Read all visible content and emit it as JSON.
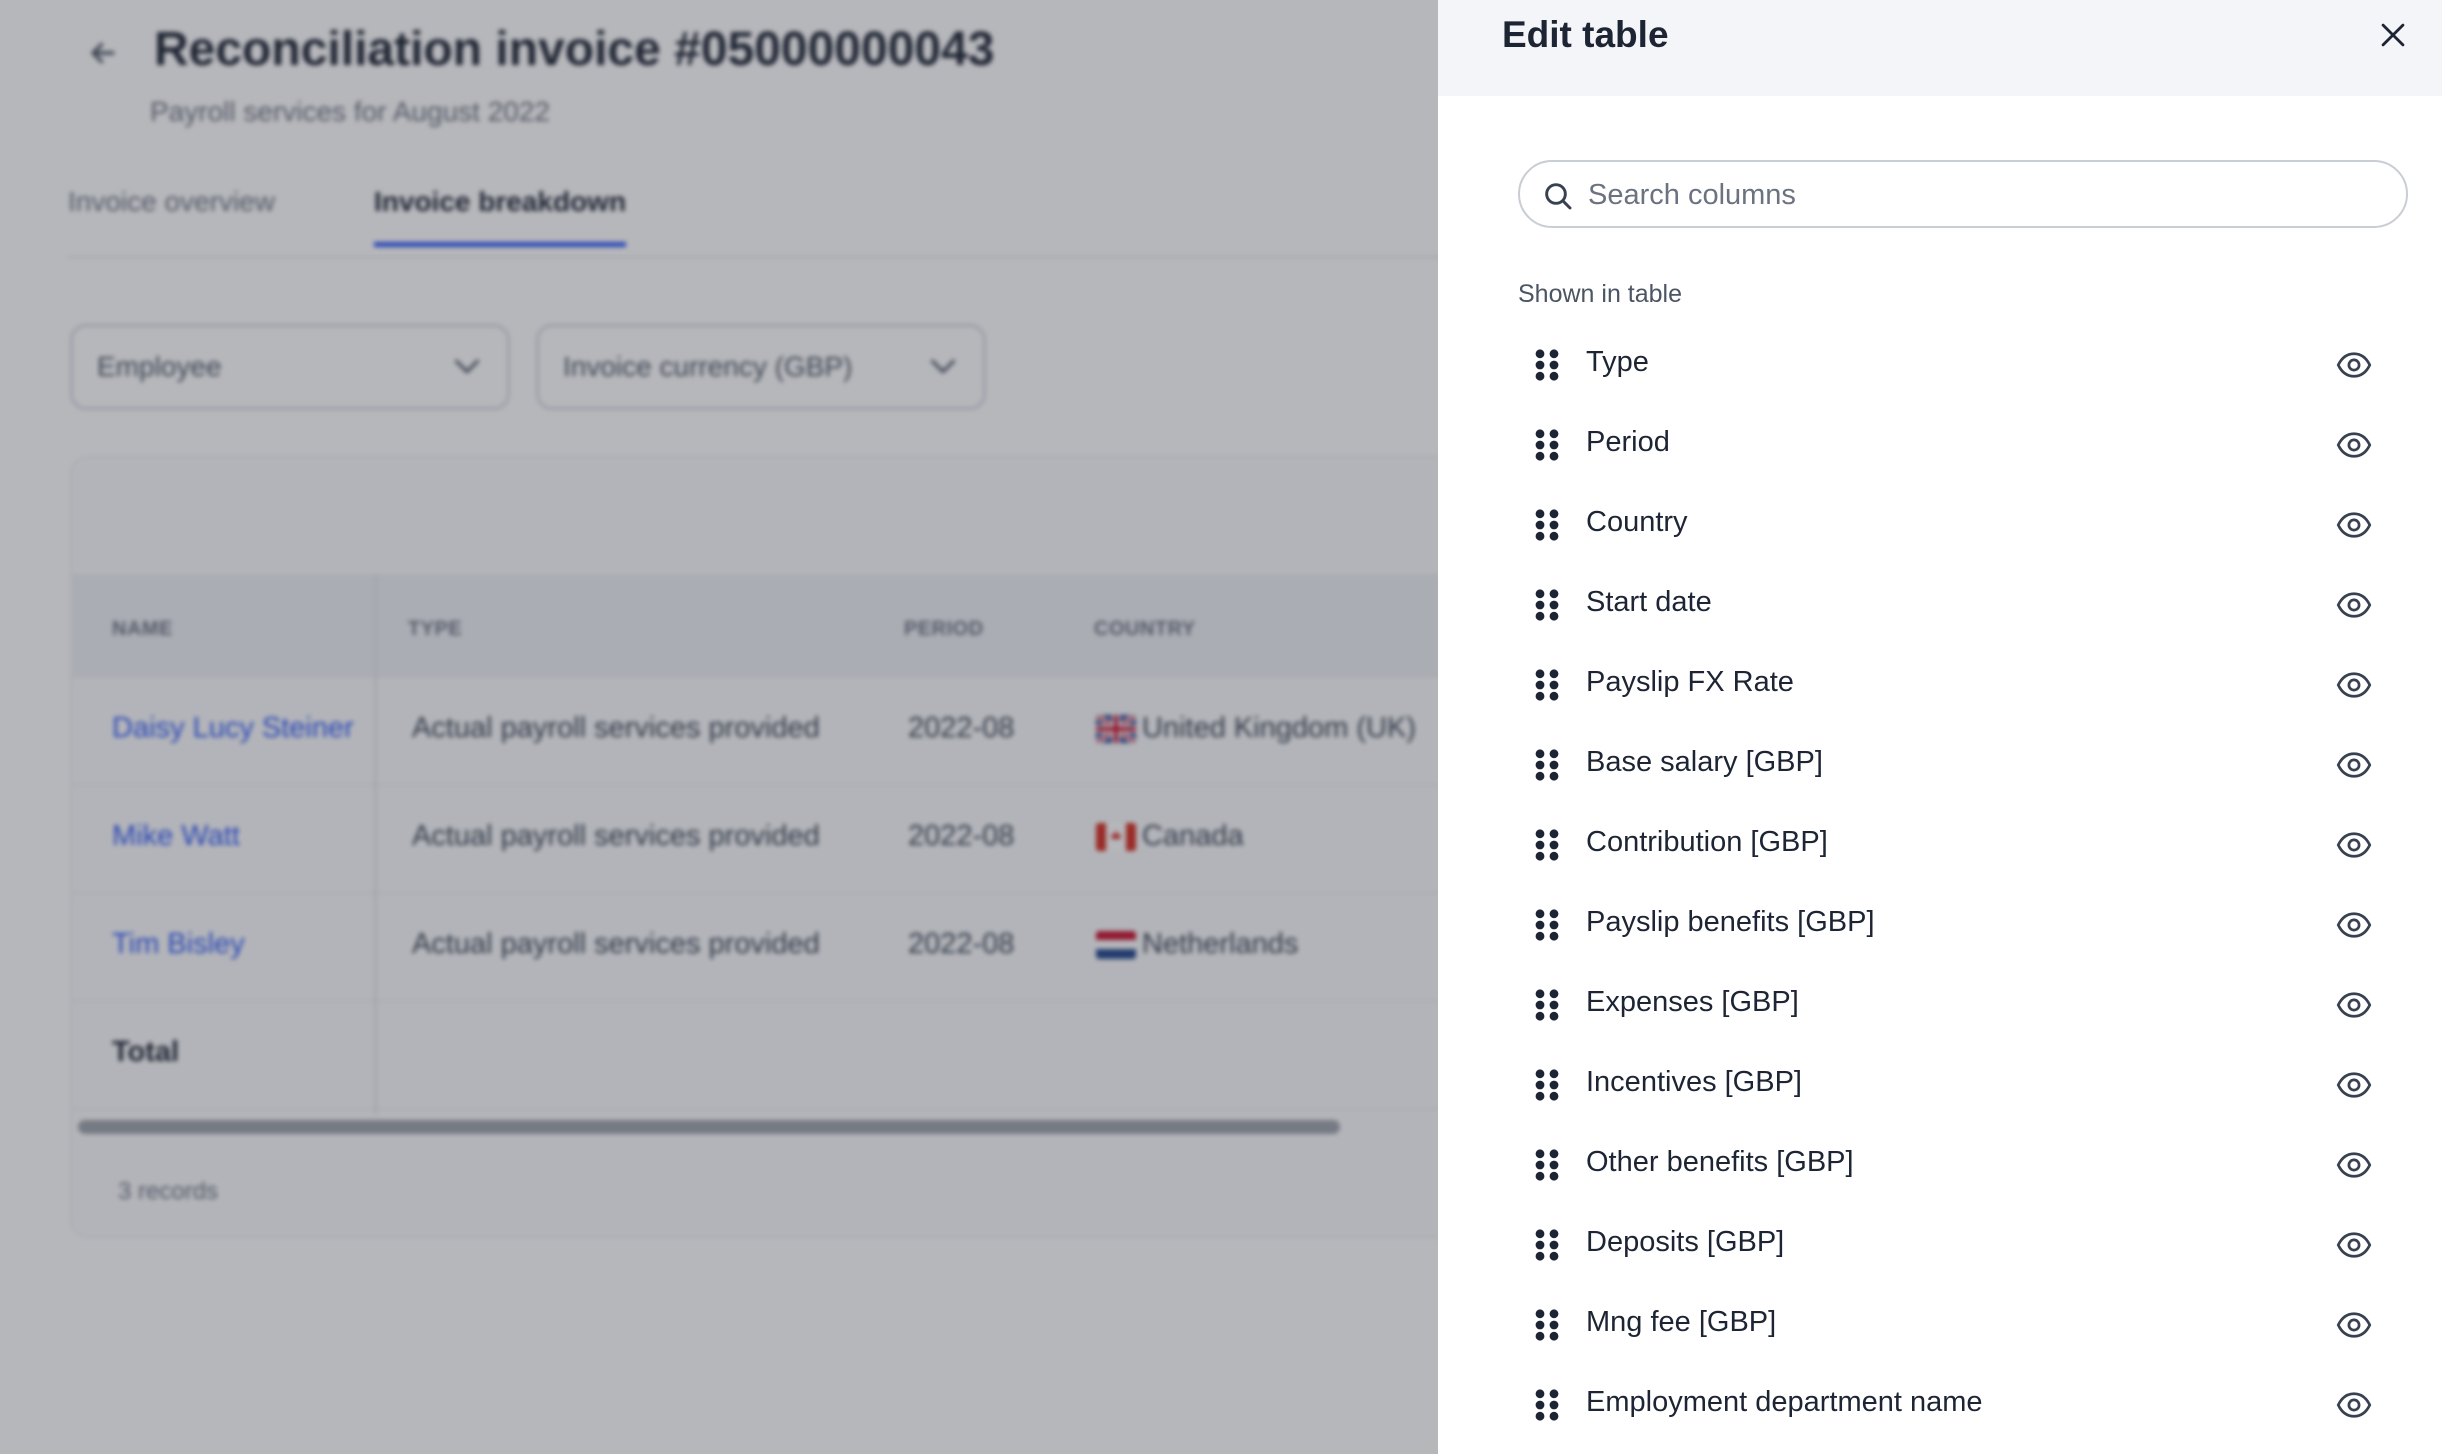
{
  "page": {
    "title": "Reconciliation invoice #05000000043",
    "subtitle": "Payroll services for August 2022",
    "tabs": [
      {
        "label": "Invoice overview"
      },
      {
        "label": "Invoice breakdown"
      }
    ],
    "filters": {
      "group_by": "Employee",
      "currency": "Invoice currency (GBP)"
    },
    "table": {
      "headers": [
        "NAME",
        "TYPE",
        "PERIOD",
        "COUNTRY"
      ],
      "rows": [
        {
          "name": "Daisy Lucy Steiner",
          "type": "Actual payroll services provided",
          "period": "2022-08",
          "country": "United Kingdom (UK)"
        },
        {
          "name": "Mike Watt",
          "type": "Actual payroll services provided",
          "period": "2022-08",
          "country": "Canada"
        },
        {
          "name": "Tim Bisley",
          "type": "Actual payroll services provided",
          "period": "2022-08",
          "country": "Netherlands"
        }
      ],
      "total_label": "Total",
      "records": "3 records"
    }
  },
  "panel": {
    "title": "Edit table",
    "search": {
      "placeholder": "Search columns",
      "value": ""
    },
    "section_label": "Shown in table",
    "columns": [
      {
        "label": "Type"
      },
      {
        "label": "Period"
      },
      {
        "label": "Country"
      },
      {
        "label": "Start date"
      },
      {
        "label": "Payslip FX Rate"
      },
      {
        "label": "Base salary [GBP]"
      },
      {
        "label": "Contribution [GBP]"
      },
      {
        "label": "Payslip benefits [GBP]"
      },
      {
        "label": "Expenses [GBP]"
      },
      {
        "label": "Incentives [GBP]"
      },
      {
        "label": "Other benefits [GBP]"
      },
      {
        "label": "Deposits [GBP]"
      },
      {
        "label": "Mng fee [GBP]"
      },
      {
        "label": "Employment department name"
      }
    ]
  },
  "icons": {
    "close": "close-icon",
    "search": "search-icon",
    "drag": "drag-handle-icon",
    "visibility": "eye-icon",
    "back": "arrow-left-icon",
    "dropdown": "chevron-down-icon"
  },
  "colors": {
    "accent": "#2c56f5",
    "panel_header_bg": "#f4f5f8",
    "overlay": "#282c38"
  }
}
